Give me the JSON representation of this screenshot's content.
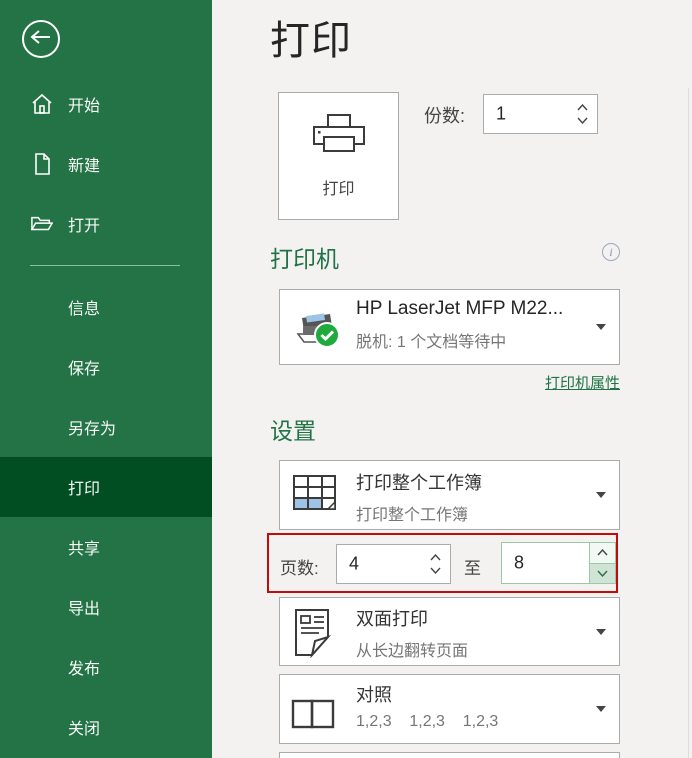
{
  "colors": {
    "sidebar_green": "#247346",
    "sidebar_selected_green": "#004e22",
    "accent_green": "#217346",
    "highlight_red": "#c40b0b",
    "main_background": "#f3f2f1"
  },
  "sidebar": {
    "back": "back",
    "top_items": [
      {
        "label": "开始",
        "icon": "home-icon"
      },
      {
        "label": "新建",
        "icon": "new-document-icon"
      },
      {
        "label": "打开",
        "icon": "open-folder-icon"
      }
    ],
    "items": [
      {
        "label": "信息",
        "active": false
      },
      {
        "label": "保存",
        "active": false
      },
      {
        "label": "另存为",
        "active": false
      },
      {
        "label": "打印",
        "active": true
      },
      {
        "label": "共享",
        "active": false
      },
      {
        "label": "导出",
        "active": false
      },
      {
        "label": "发布",
        "active": false
      },
      {
        "label": "关闭",
        "active": false
      }
    ]
  },
  "main": {
    "title": "打印",
    "print_button_label": "打印",
    "copies": {
      "label": "份数:",
      "value": "1"
    },
    "printer": {
      "heading": "打印机",
      "name": "HP LaserJet MFP M22...",
      "status": "脱机: 1 个文档等待中",
      "properties_link": "打印机属性",
      "info_glyph": "i"
    },
    "settings": {
      "heading": "设置",
      "print_what": {
        "primary": "打印整个工作簿",
        "secondary": "打印整个工作簿"
      },
      "pages": {
        "label": "页数:",
        "from_value": "4",
        "to_label": "至",
        "to_value": "8"
      },
      "duplex": {
        "primary": "双面打印",
        "secondary": "从长边翻转页面"
      },
      "collation": {
        "primary": "对照",
        "secondary": "1,2,3    1,2,3    1,2,3"
      }
    }
  }
}
